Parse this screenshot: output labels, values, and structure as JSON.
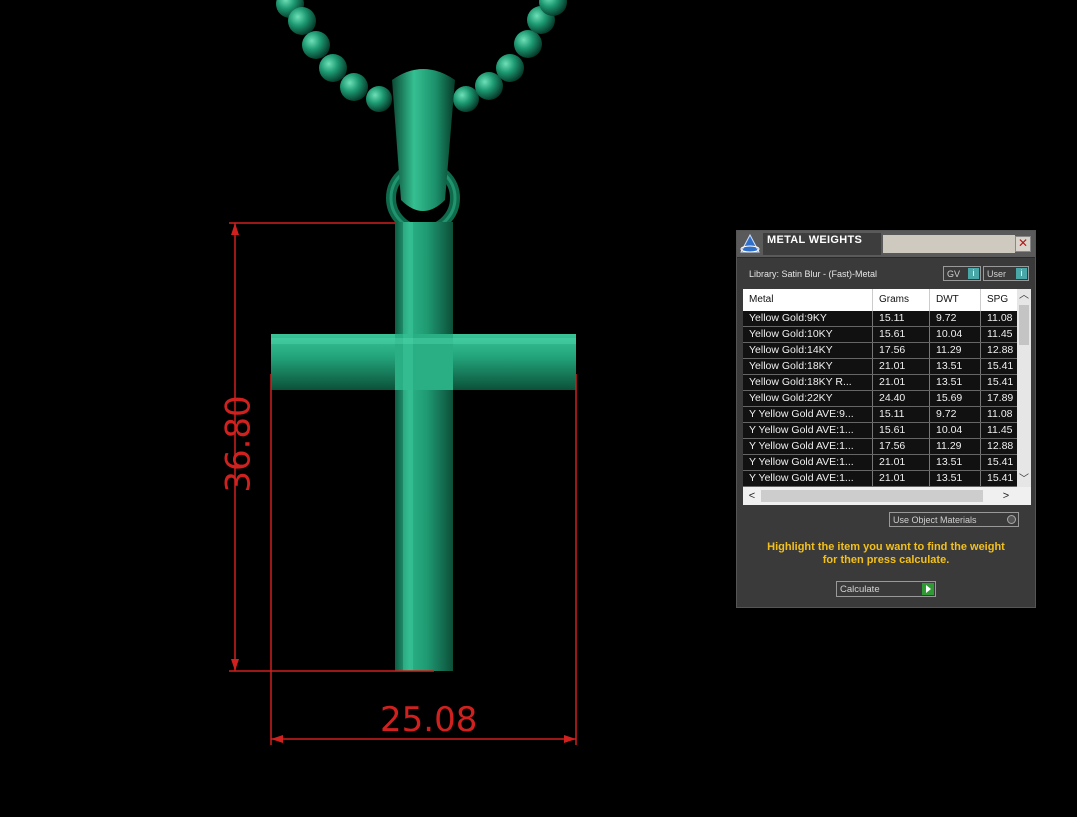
{
  "viewport": {
    "dimension_height": "36.80",
    "dimension_width": "25.08",
    "dimension_color": "#d0211f",
    "model_color": "#1e9a72"
  },
  "panel": {
    "title": "METAL WEIGHTS",
    "close_icon": "close-icon",
    "library_label": "Library: Satin Blur - (Fast)-Metal",
    "gv_label": "GV",
    "user_label": "User",
    "columns": [
      "Metal",
      "Grams",
      "DWT",
      "SPG"
    ],
    "rows": [
      [
        "Yellow Gold:9KY",
        "15.11",
        "9.72",
        "11.08"
      ],
      [
        "Yellow Gold:10KY",
        "15.61",
        "10.04",
        "11.45"
      ],
      [
        "Yellow Gold:14KY",
        "17.56",
        "11.29",
        "12.88"
      ],
      [
        "Yellow Gold:18KY",
        "21.01",
        "13.51",
        "15.41"
      ],
      [
        "Yellow Gold:18KY R...",
        "21.01",
        "13.51",
        "15.41"
      ],
      [
        "Yellow Gold:22KY",
        "24.40",
        "15.69",
        "17.89"
      ],
      [
        "Y Yellow Gold AVE:9...",
        "15.11",
        "9.72",
        "11.08"
      ],
      [
        "Y Yellow Gold AVE:1...",
        "15.61",
        "10.04",
        "11.45"
      ],
      [
        "Y Yellow Gold AVE:1...",
        "17.56",
        "11.29",
        "12.88"
      ],
      [
        "Y Yellow Gold AVE:1...",
        "21.01",
        "13.51",
        "15.41"
      ],
      [
        "Y Yellow Gold AVE:1...",
        "21.01",
        "13.51",
        "15.41"
      ]
    ],
    "use_object_materials_label": "Use Object Materials",
    "instruction_line1": "Highlight the item you want to find the weight",
    "instruction_line2": "for then press calculate.",
    "calculate_label": "Calculate",
    "accent_color": "#f2c01c"
  }
}
